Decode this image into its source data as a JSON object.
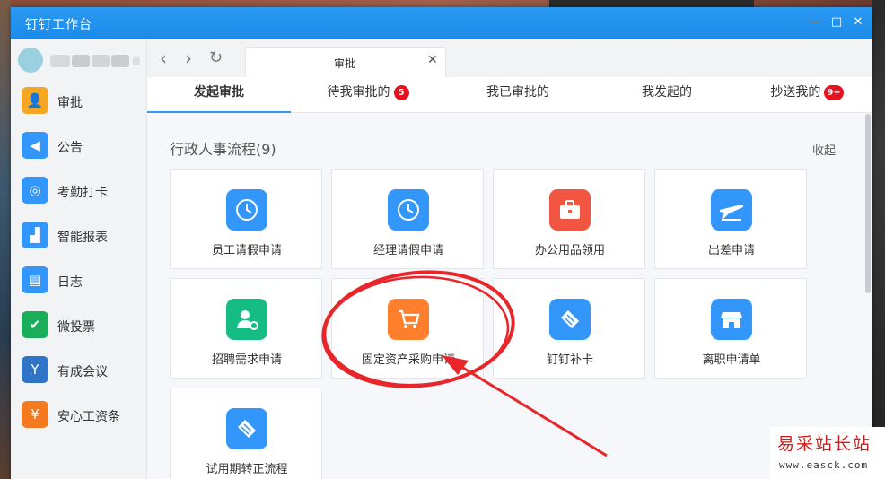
{
  "window": {
    "title": "钉钉工作台",
    "minimize_glyph": "—",
    "maximize_glyph": "□",
    "close_glyph": "✕"
  },
  "sidebar": {
    "items": [
      {
        "label": "审批",
        "icon": "approval-icon",
        "color": "#f5a623",
        "glyph": "👤"
      },
      {
        "label": "公告",
        "icon": "speaker-icon",
        "color": "#3296fa",
        "glyph": "◀"
      },
      {
        "label": "考勤打卡",
        "icon": "location-icon",
        "color": "#3296fa",
        "glyph": "◎"
      },
      {
        "label": "智能报表",
        "icon": "chart-icon",
        "color": "#3296fa",
        "glyph": "▟"
      },
      {
        "label": "日志",
        "icon": "notebook-icon",
        "color": "#3296fa",
        "glyph": "▤"
      },
      {
        "label": "微投票",
        "icon": "vote-icon",
        "color": "#1aad5a",
        "glyph": "✔"
      },
      {
        "label": "有成会议",
        "icon": "meeting-icon",
        "color": "#2f74c7",
        "glyph": "Y"
      },
      {
        "label": "安心工资条",
        "icon": "salary-icon",
        "color": "#f47a20",
        "glyph": "¥"
      }
    ]
  },
  "nav": {
    "back_glyph": "‹",
    "forward_glyph": "›",
    "refresh_glyph": "↻",
    "tab_label": "审批",
    "tab_close": "✕"
  },
  "subtabs": [
    {
      "label": "发起审批",
      "badge": ""
    },
    {
      "label": "待我审批的",
      "badge": "5"
    },
    {
      "label": "我已审批的",
      "badge": ""
    },
    {
      "label": "我发起的",
      "badge": ""
    },
    {
      "label": "抄送我的",
      "badge": "9+"
    }
  ],
  "section": {
    "title": "行政人事流程(9)",
    "collapse_label": "收起"
  },
  "cards": [
    {
      "label": "员工请假申请",
      "icon": "clock-icon",
      "color": "#3296fa"
    },
    {
      "label": "经理请假申请",
      "icon": "clock-icon",
      "color": "#3296fa"
    },
    {
      "label": "办公用品领用",
      "icon": "toolbox-icon",
      "color": "#f25643"
    },
    {
      "label": "出差申请",
      "icon": "airplane-icon",
      "color": "#3296fa"
    },
    {
      "label": "招聘需求申请",
      "icon": "recruit-icon",
      "color": "#15bc83"
    },
    {
      "label": "固定资产采购申请",
      "icon": "cart-icon",
      "color": "#ff7f2c"
    },
    {
      "label": "钉钉补卡",
      "icon": "handshake-icon",
      "color": "#3296fa"
    },
    {
      "label": "离职申请单",
      "icon": "store-icon",
      "color": "#3296fa"
    },
    {
      "label": "试用期转正流程",
      "icon": "handshake-icon",
      "color": "#3296fa"
    }
  ],
  "watermark": {
    "text": "易采站长站",
    "url": "www.easck.com"
  }
}
